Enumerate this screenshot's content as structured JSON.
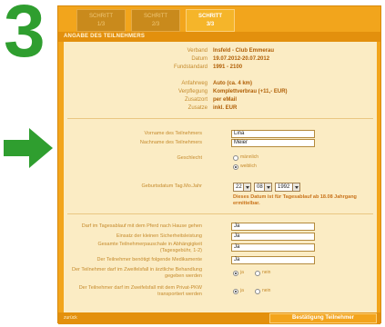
{
  "step": {
    "number": "3"
  },
  "icons": {
    "arrow": "arrow-right-icon",
    "dropdown": "chevron-down-icon"
  },
  "colors": {
    "accent_green": "#2f9e2f",
    "frame_orange": "#f2a51c",
    "panel_cream": "#fbecc4"
  },
  "tabs": [
    {
      "label": "SCHRITT",
      "sub": "1/3"
    },
    {
      "label": "SCHRITT",
      "sub": "2/3"
    },
    {
      "label": "SCHRITT",
      "sub": "3/3"
    }
  ],
  "active_tab": 2,
  "section": {
    "title": "ANGABE DES TEILNEHMERS"
  },
  "summary": [
    {
      "key": "Verband",
      "value": "Insfeld - Club Emmerau"
    },
    {
      "key": "Datum",
      "value": "19.07.2012-20.07.2012"
    },
    {
      "key": "Fundstandard",
      "value": "1991 - 2100"
    },
    {
      "key": "Anfahrweg",
      "value": "Auto (ca. 4 km)"
    },
    {
      "key": "Verpflegung",
      "value": "Komplettverbrau (+11,- EUR)"
    },
    {
      "key": "Zusatzort",
      "value": "per eMail"
    },
    {
      "key": "Zusatze",
      "value": "inkl. EUR"
    }
  ],
  "form": {
    "firstname_label": "Vorname des Teilnehmers",
    "firstname_value": "Lina",
    "lastname_label": "Nachname des Teilnehmers",
    "lastname_value": "Meier",
    "gender_label": "Geschlecht",
    "gender_options": [
      "männlich",
      "weiblich"
    ],
    "birth_label": "Geburtsdatum Tag.Mo.Jahr",
    "birth_day": "22",
    "birth_month": "08",
    "birth_year": "1992",
    "birth_hint": "Dieses Datum ist für Tagesablauf ab 18.08 Jahrgang ermittelbar.",
    "q1_label": "Darf im Tagesablauf mit dem Pferd nach Hause gehen",
    "q1_value": "Ja",
    "q2_label": "Einsatz der kleinen Sicherheitsleistung",
    "q2_value": "Ja",
    "q3_label": "Gesamte Teilnehmerpauschale in Abhängigkeit (Tagesgebühr, 1-2)",
    "q3_value": "Ja",
    "q4_label": "Der Teilnehmer benötigt folgende Medikamente",
    "q4_value": "Ja",
    "q5_label": "Der Teilnehmer darf im Zweifelsfall in ärztliche Behandlung gegeben werden",
    "q5_yes": "ja",
    "q5_no": "nein",
    "q6_label": "Der Teilnehmer darf im Zweifelsfall mit dem Privat-PKW transportiert werden",
    "q6_yes": "ja",
    "q6_no": "nein"
  },
  "footer": {
    "back_label": "zurück",
    "confirm_label": "Bestätigung Teilnehmer"
  }
}
